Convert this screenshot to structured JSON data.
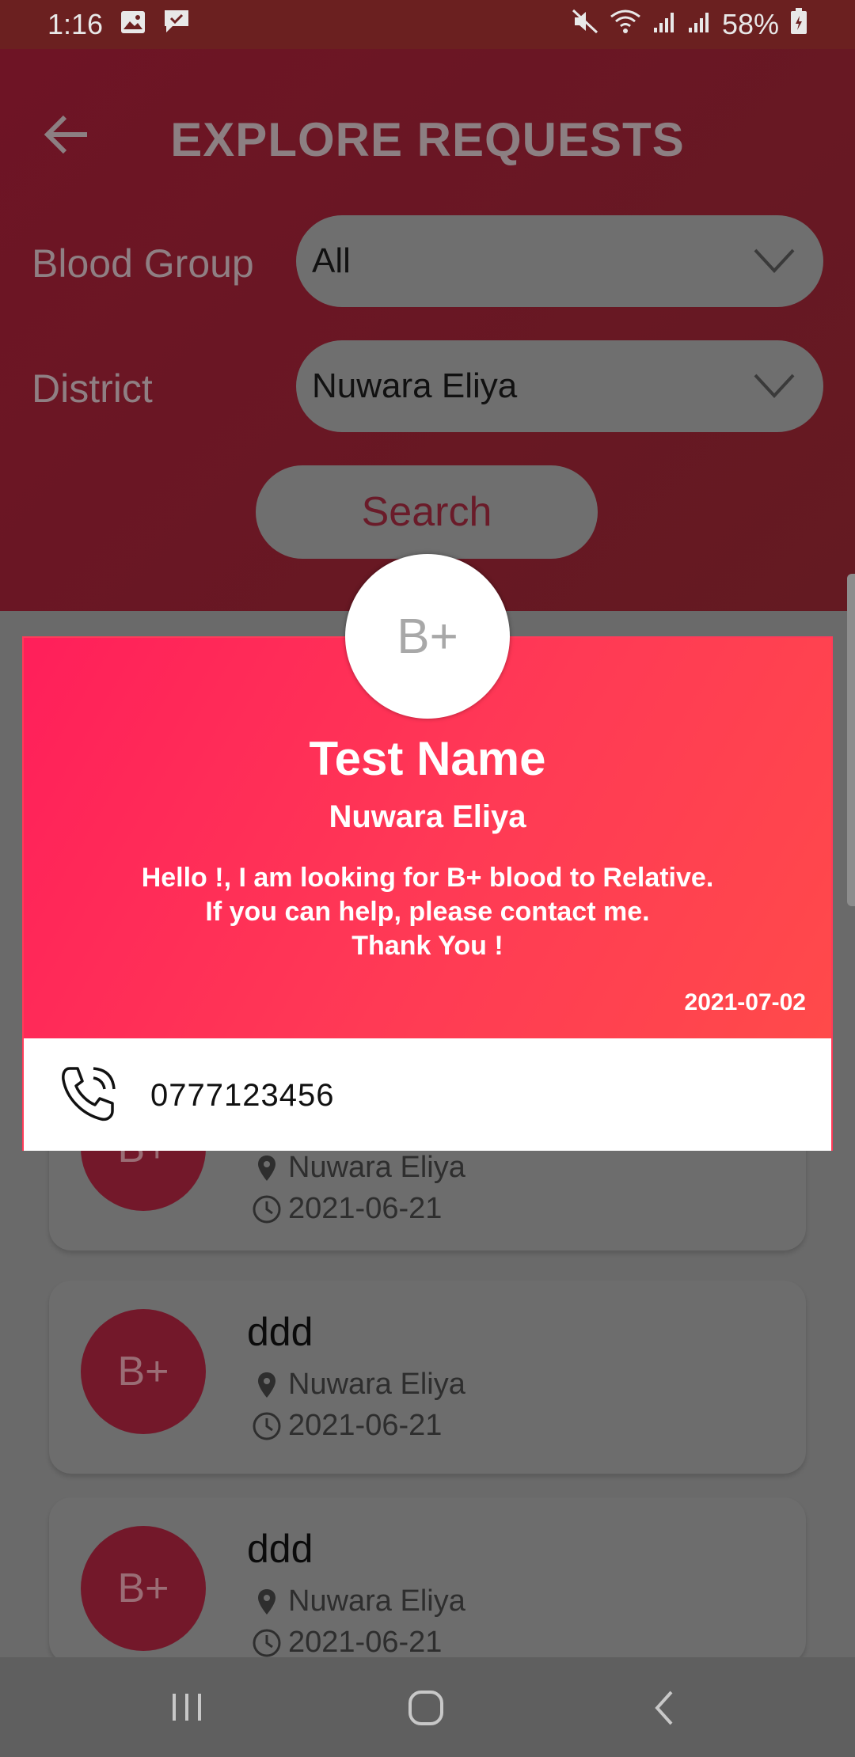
{
  "status_bar": {
    "time": "1:16",
    "battery": "58%",
    "icons": [
      "image-icon",
      "message-icon",
      "mute-icon",
      "wifi-icon",
      "signal-icon",
      "signal-icon",
      "battery-icon"
    ]
  },
  "header": {
    "title": "EXPLORE REQUESTS",
    "back_icon": "arrow-left-icon",
    "blood_group_label": "Blood Group",
    "blood_group_value": "All",
    "district_label": "District",
    "district_value": "Nuwara Eliya",
    "search_label": "Search"
  },
  "modal": {
    "blood_type": "B+",
    "name": "Test Name",
    "district": "Nuwara Eliya",
    "message_lines": [
      "Hello !, I am looking for B+ blood to Relative.",
      "If you can help, please contact me.",
      "Thank You !"
    ],
    "date": "2021-07-02",
    "phone": "0777123456",
    "colors": {
      "gradient_start": "#ff1f5a",
      "gradient_end": "#ff4a4a"
    }
  },
  "list": [
    {
      "blood_type": "B+",
      "name": "",
      "district": "Nuwara Eliya",
      "date": "2021-06-21"
    },
    {
      "blood_type": "B+",
      "name": "ddd",
      "district": "Nuwara Eliya",
      "date": "2021-06-21"
    },
    {
      "blood_type": "B+",
      "name": "ddd",
      "district": "Nuwara Eliya",
      "date": "2021-06-21"
    }
  ]
}
